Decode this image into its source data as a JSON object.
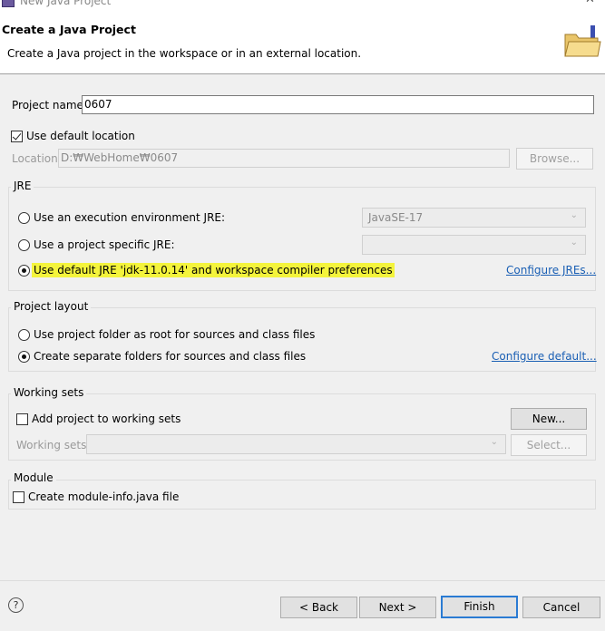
{
  "window": {
    "title": "New Java Project",
    "minimize_glyph": "—",
    "close_glyph": "✕"
  },
  "header": {
    "title": "Create a Java Project",
    "description": "Create a Java project in the workspace or in an external location."
  },
  "project": {
    "name_label": "Project name:",
    "name_value": "0607"
  },
  "location": {
    "use_default_label": "Use default location",
    "use_default_checked": true,
    "location_label": "Location:",
    "location_value": "D:₩WebHome₩0607",
    "browse_label": "Browse..."
  },
  "jre": {
    "group_label": "JRE",
    "options": [
      {
        "label": "Use an execution environment JRE:",
        "selected": false
      },
      {
        "label": "Use a project specific JRE:",
        "selected": false
      },
      {
        "label": "Use default JRE 'jdk-11.0.14' and workspace compiler preferences",
        "selected": true
      }
    ],
    "exec_env_value": "JavaSE-17",
    "project_jre_value": "",
    "configure_link": "Configure JREs..."
  },
  "layout": {
    "group_label": "Project layout",
    "options": [
      {
        "label": "Use project folder as root for sources and class files",
        "selected": false
      },
      {
        "label": "Create separate folders for sources and class files",
        "selected": true
      }
    ],
    "configure_link": "Configure default..."
  },
  "working_sets": {
    "group_label": "Working sets",
    "add_label": "Add project to working sets",
    "add_checked": false,
    "new_label": "New...",
    "sets_label": "Working sets:",
    "select_label": "Select..."
  },
  "module": {
    "group_label": "Module",
    "create_label": "Create module-info.java file",
    "create_checked": false
  },
  "footer": {
    "help_glyph": "?",
    "back_label": "< Back",
    "next_label": "Next >",
    "finish_label": "Finish",
    "cancel_label": "Cancel"
  },
  "colors": {
    "highlight": "#f4f43c",
    "link": "#1a5fb4",
    "default_button_border": "#2a7bd3"
  },
  "icons": [
    "eclipse-app-icon",
    "folder-icon",
    "chevron-down-icon",
    "help-icon"
  ]
}
